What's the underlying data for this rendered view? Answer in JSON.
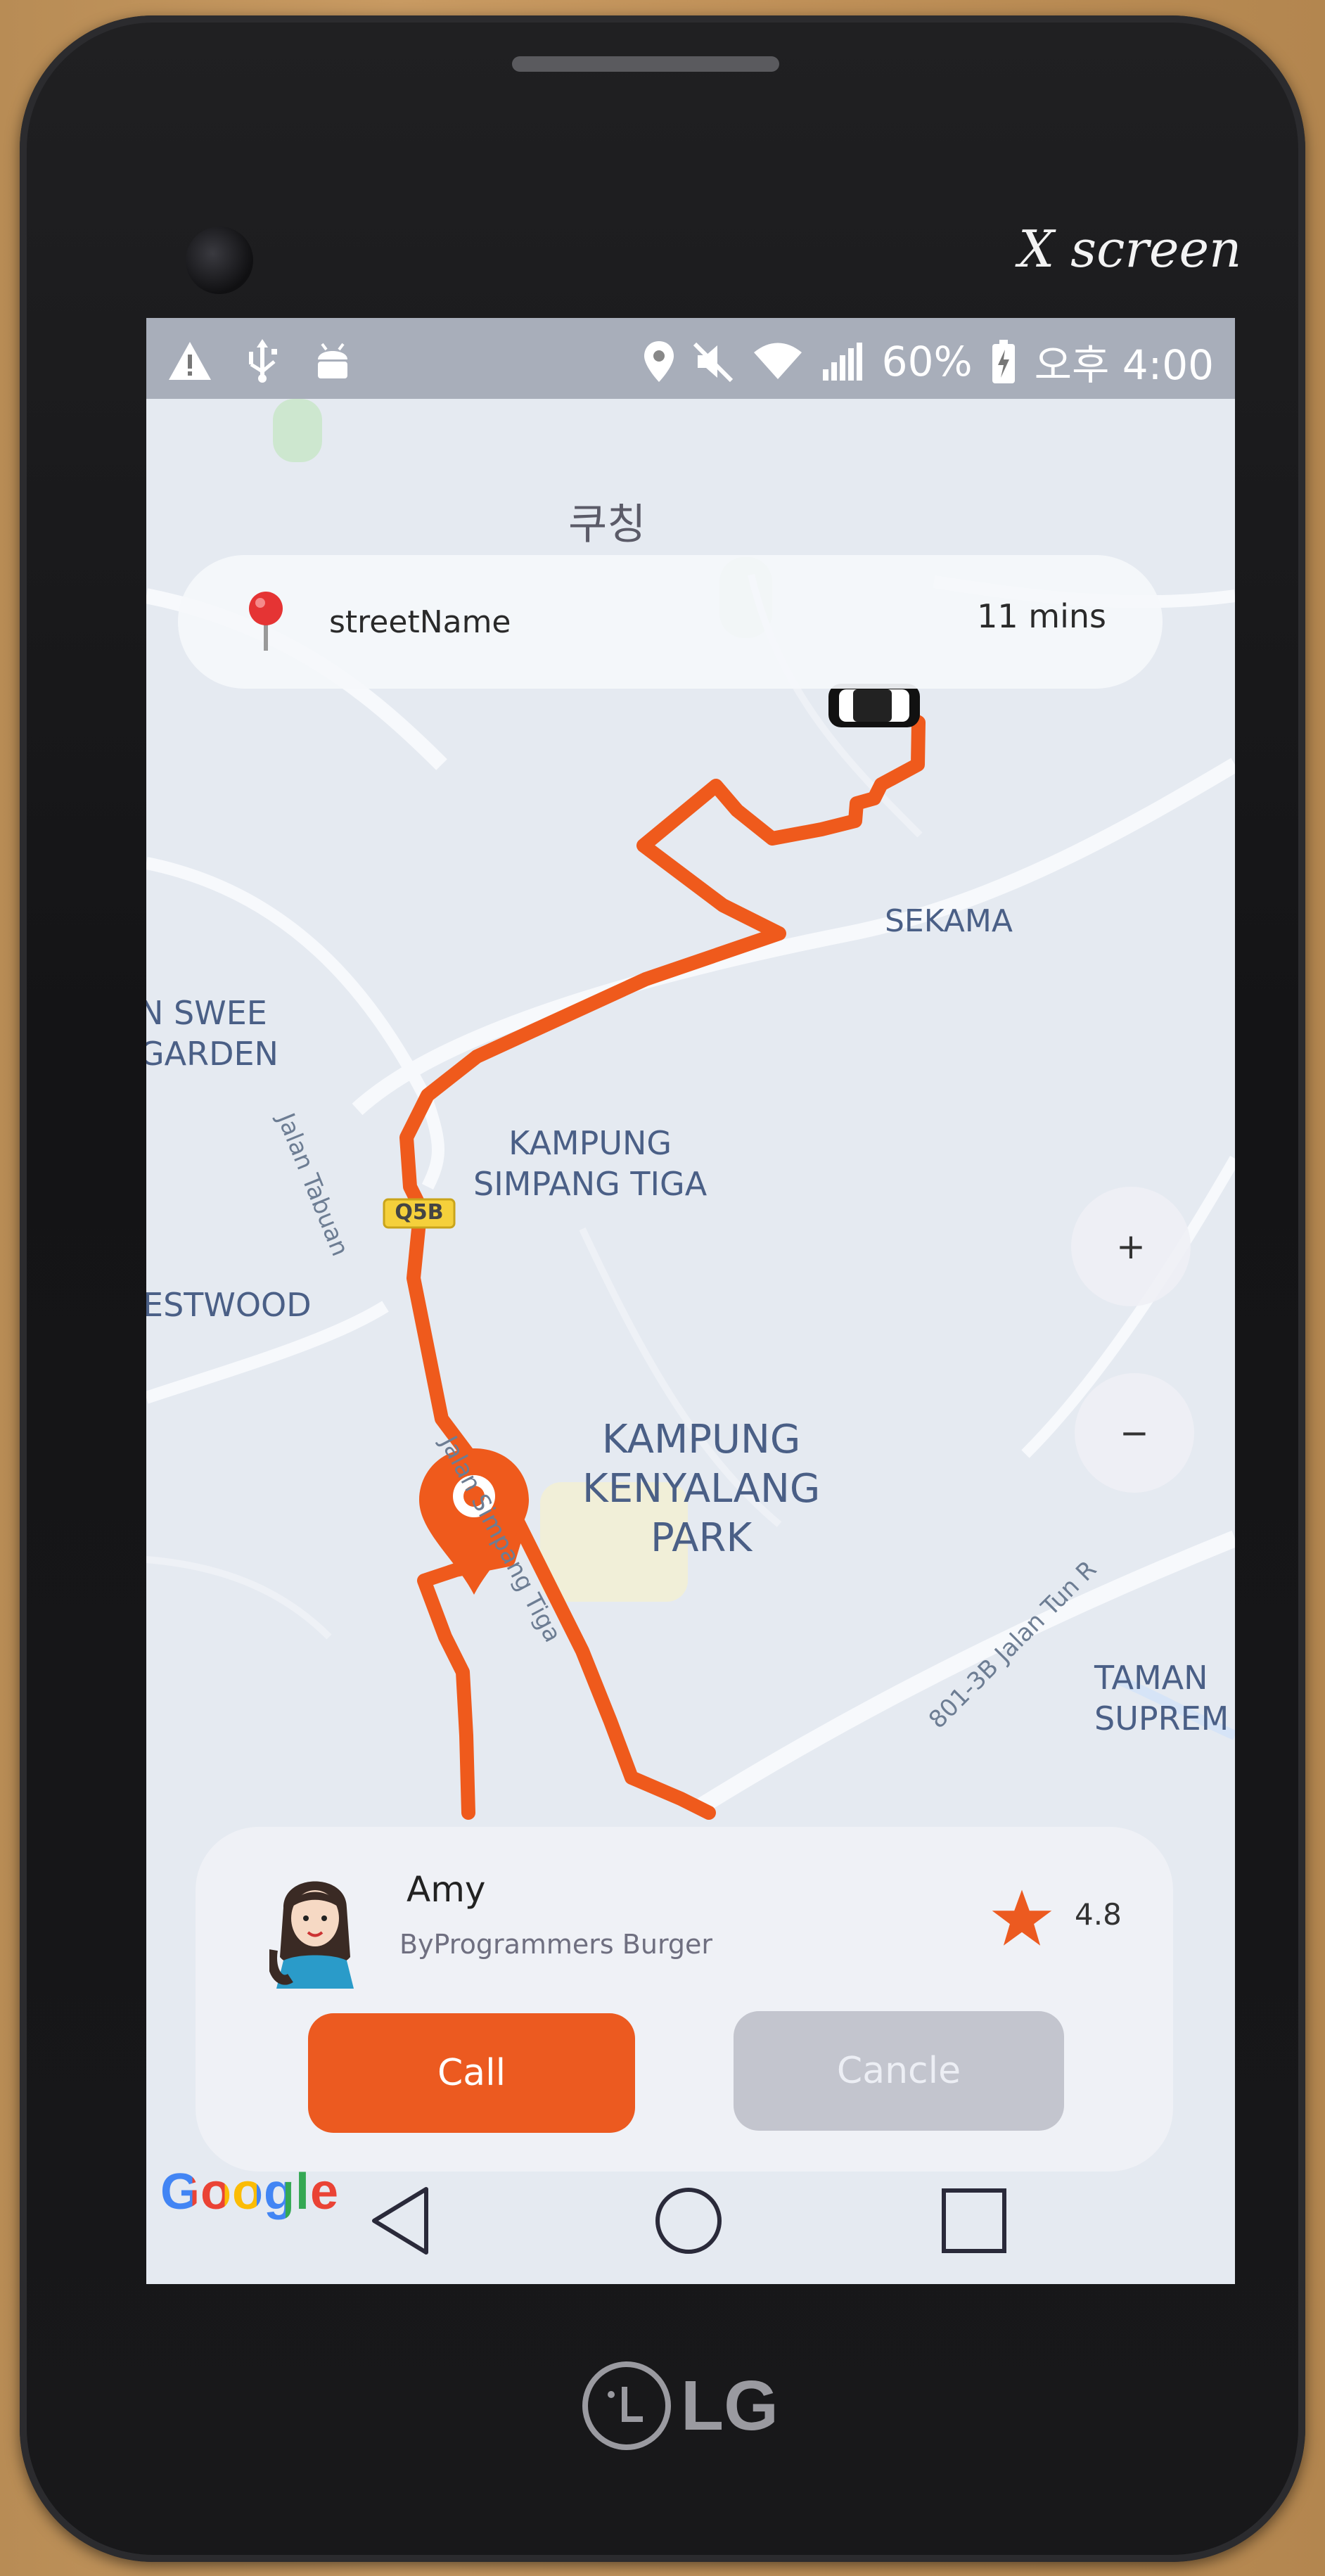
{
  "device": {
    "brand_top": "X screen",
    "brand_bottom": "LG"
  },
  "status_bar": {
    "battery": "60%",
    "time": "오후 4:00",
    "icons": [
      "warning-icon",
      "usb-icon",
      "android-icon",
      "location-icon",
      "mute-icon",
      "wifi-icon",
      "signal-icon",
      "battery-charging-icon"
    ]
  },
  "map": {
    "city_label": "쿠칭",
    "places": {
      "sekama": "SEKAMA",
      "swee_garden": "N SWEE\nGARDEN",
      "simpang_tiga": "KAMPUNG\nSIMPANG TIGA",
      "westwood": "ESTWOOD",
      "kenyalang_park": "KAMPUNG\nKENYALANG\nPARK",
      "taman_supreme": "TAMAN\nSUPREM"
    },
    "roads": {
      "jalan_tabuan": "Jalan Tabuan",
      "jalan_simpang_tiga": "Jalan Simpang Tiga",
      "jalan_tun_r": "801-3B Jalan Tun R",
      "road_badge": "Q5B"
    },
    "route_color": "#ef5a1c",
    "attribution": "Google"
  },
  "search_bar": {
    "street": "streetName",
    "eta": "11 mins"
  },
  "zoom": {
    "plus": "+",
    "minus": "−"
  },
  "driver_card": {
    "name": "Amy",
    "subtitle": "ByProgrammers Burger",
    "rating": "4.8",
    "call_label": "Call",
    "cancel_label": "Cancle"
  },
  "colors": {
    "accent": "#ec5a20",
    "cancel_bg": "#c3c5ce",
    "map_bg": "#e5eaf1"
  }
}
